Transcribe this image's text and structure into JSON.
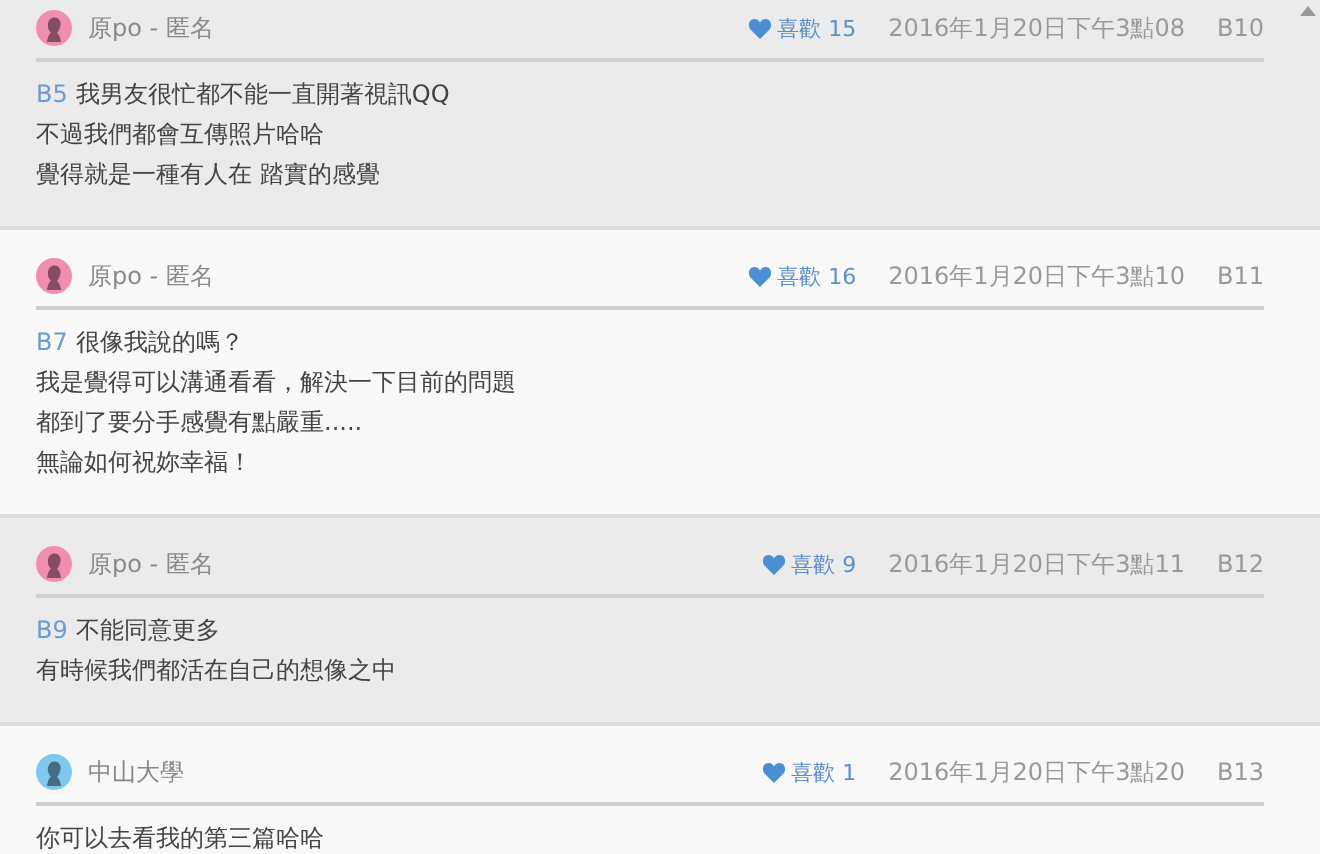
{
  "comments": [
    {
      "author": "原po - 匿名",
      "color": "#f28db2",
      "likes": "喜歡 15",
      "time": "2016年1月20日下午3點08",
      "floor": "B10",
      "shaded": true,
      "reply_to": "B5",
      "lines": [
        "我男友很忙都不能一直開著視訊QQ",
        "不過我們都會互傳照片哈哈",
        "覺得就是一種有人在 踏實的感覺"
      ]
    },
    {
      "author": "原po - 匿名",
      "color": "#f28db2",
      "likes": "喜歡 16",
      "time": "2016年1月20日下午3點10",
      "floor": "B11",
      "shaded": false,
      "reply_to": "B7",
      "lines": [
        "很像我說的嗎？",
        "我是覺得可以溝通看看，解決一下目前的問題",
        "都到了要分手感覺有點嚴重.....",
        "無論如何祝妳幸福！"
      ]
    },
    {
      "author": "原po - 匿名",
      "color": "#f28db2",
      "likes": "喜歡 9",
      "time": "2016年1月20日下午3點11",
      "floor": "B12",
      "shaded": true,
      "reply_to": "B9",
      "lines": [
        "不能同意更多",
        "有時候我們都活在自己的想像之中"
      ]
    },
    {
      "author": "中山大學",
      "color": "#7fc8f0",
      "likes": "喜歡 1",
      "time": "2016年1月20日下午3點20",
      "floor": "B13",
      "shaded": false,
      "lines": [
        "你可以去看我的第三篇哈哈"
      ]
    }
  ]
}
